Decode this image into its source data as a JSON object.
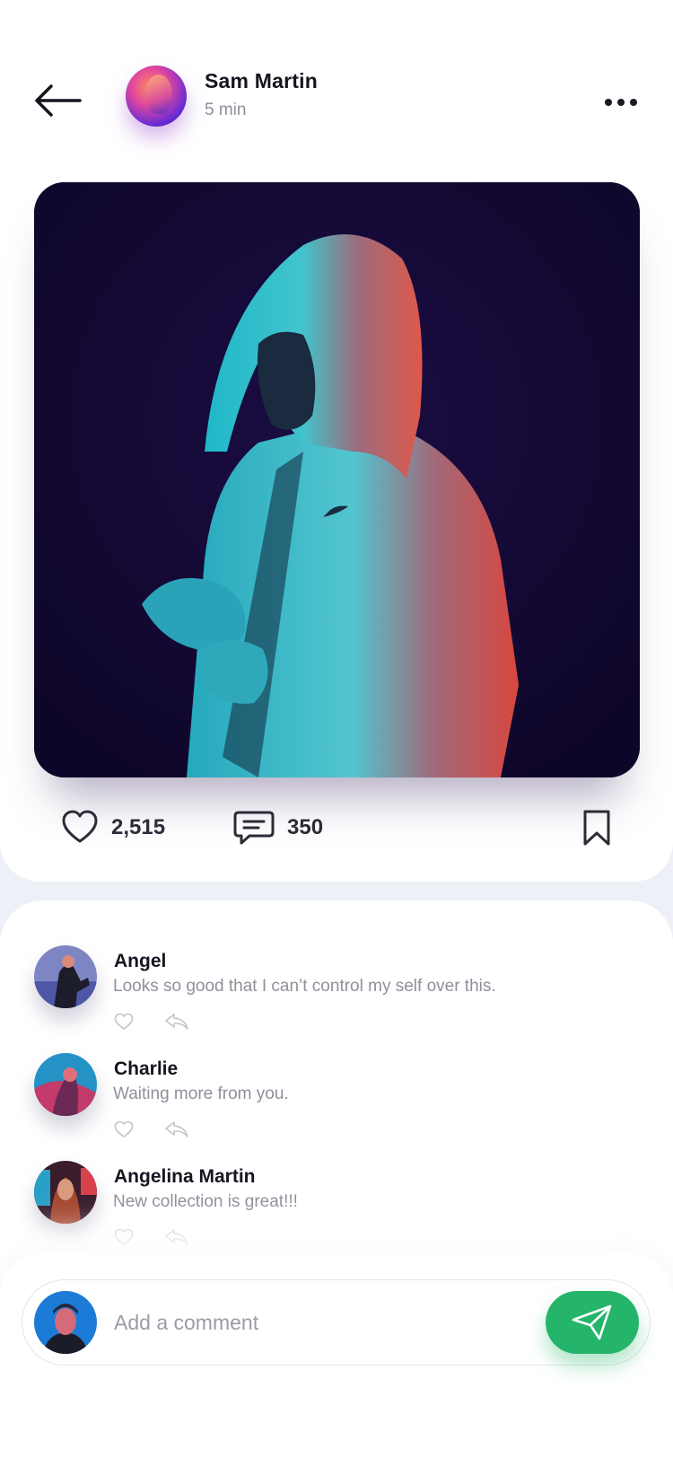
{
  "header": {
    "back_icon": "arrow-left-icon",
    "author_name": "Sam Martin",
    "time_ago": "5 min",
    "more_icon": "more-horizontal-icon"
  },
  "post": {
    "image_alt": "Person in a hooded Nike jacket lit with teal and red light",
    "likes": "2,515",
    "comments": "350",
    "icons": [
      "heart-icon",
      "comment-bubble-icon",
      "bookmark-icon"
    ]
  },
  "comments": [
    {
      "name": "Angel",
      "text": "Looks so good that I can’t control my self over this."
    },
    {
      "name": "Charlie",
      "text": "Waiting more from you."
    },
    {
      "name": "Angelina Martin",
      "text": "New collection is great!!!"
    }
  ],
  "composer": {
    "placeholder": "Add a comment",
    "send_icon": "paper-plane-icon"
  },
  "colors": {
    "accent": "#24b56b",
    "text_primary": "#15151f",
    "text_secondary": "#8e909c",
    "background": "#eef0f7"
  }
}
